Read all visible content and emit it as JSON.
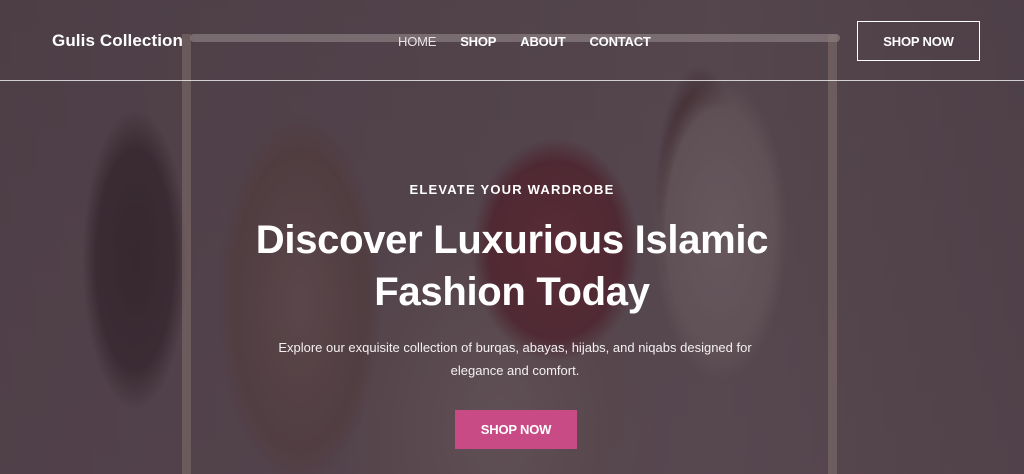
{
  "header": {
    "brand": "Gulis Collection",
    "nav": [
      {
        "label": "HOME",
        "active": true
      },
      {
        "label": "SHOP",
        "active": false
      },
      {
        "label": "ABOUT",
        "active": false
      },
      {
        "label": "CONTACT",
        "active": false
      }
    ],
    "cta_label": "SHOP NOW"
  },
  "hero": {
    "eyebrow": "ELEVATE YOUR WARDROBE",
    "title": "Discover Luxurious Islamic Fashion Today",
    "description": "Explore our exquisite collection of burqas, abayas, hijabs, and niqabs designed for elegance and comfort.",
    "cta_label": "SHOP NOW",
    "cta_color": "#c94b85",
    "background_image": "woman-in-hijab-browsing-clothing-rack"
  }
}
